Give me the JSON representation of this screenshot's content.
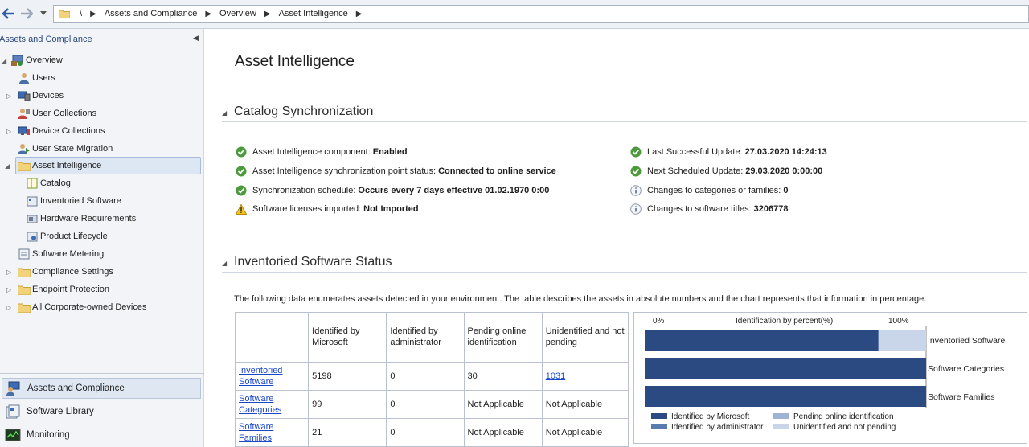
{
  "breadcrumb": {
    "root": "\\",
    "items": [
      "Assets and Compliance",
      "Overview",
      "Asset Intelligence"
    ]
  },
  "nav": {
    "header": "Assets and Compliance",
    "tree": [
      {
        "label": "Overview",
        "icon": "overview-icon"
      },
      {
        "label": "Users",
        "icon": "user-icon"
      },
      {
        "label": "Devices",
        "icon": "devices-icon"
      },
      {
        "label": "User Collections",
        "icon": "user-collection-icon"
      },
      {
        "label": "Device Collections",
        "icon": "device-collection-icon"
      },
      {
        "label": "User State Migration",
        "icon": "migration-icon"
      },
      {
        "label": "Asset Intelligence",
        "icon": "folder-icon"
      },
      {
        "label": "Catalog",
        "icon": "catalog-icon"
      },
      {
        "label": "Inventoried Software",
        "icon": "software-icon"
      },
      {
        "label": "Hardware Requirements",
        "icon": "hardware-icon"
      },
      {
        "label": "Product Lifecycle",
        "icon": "lifecycle-icon"
      },
      {
        "label": "Software Metering",
        "icon": "metering-icon"
      },
      {
        "label": "Compliance Settings",
        "icon": "folder-icon"
      },
      {
        "label": "Endpoint Protection",
        "icon": "folder-icon"
      },
      {
        "label": "All Corporate-owned Devices",
        "icon": "folder-icon"
      }
    ],
    "workspaces": [
      {
        "label": "Assets and Compliance",
        "icon": "assets-icon"
      },
      {
        "label": "Software Library",
        "icon": "library-icon"
      },
      {
        "label": "Monitoring",
        "icon": "monitoring-icon"
      }
    ]
  },
  "page": {
    "title": "Asset Intelligence",
    "catalog_section": "Catalog Synchronization",
    "inventory_section": "Inventoried Software Status",
    "status_left": [
      {
        "label": "Asset Intelligence component:",
        "value": "Enabled",
        "icon": "check-icon"
      },
      {
        "label": "Asset Intelligence synchronization point status:",
        "value": "Connected to online service",
        "icon": "check-icon"
      },
      {
        "label": "Synchronization schedule:",
        "value": "Occurs every 7 days effective 01.02.1970 0:00",
        "icon": "check-icon"
      },
      {
        "label": "Software licenses imported:",
        "value": "Not Imported",
        "icon": "warning-icon"
      }
    ],
    "status_right": [
      {
        "label": "Last Successful Update:",
        "value": "27.03.2020 14:24:13",
        "icon": "check-icon"
      },
      {
        "label": "Next Scheduled Update:",
        "value": "29.03.2020 0:00:00",
        "icon": "check-icon"
      },
      {
        "label": "Changes to categories or families:",
        "value": "0",
        "icon": "info-icon"
      },
      {
        "label": "Changes to software titles:",
        "value": "3206778",
        "icon": "info-icon"
      }
    ],
    "description": "The following data enumerates assets detected in your environment. The table describes the assets in absolute numbers and the chart represents that information in percentage."
  },
  "table": {
    "headers": [
      "",
      "Identified by Microsoft",
      "Identified by administrator",
      "Pending online identification",
      "Unidentified and not pending"
    ],
    "rows": [
      {
        "name": "Inventoried Software",
        "cells": [
          "5198",
          "0",
          "30",
          "1031"
        ]
      },
      {
        "name": "Software Categories",
        "cells": [
          "99",
          "0",
          "Not Applicable",
          "Not Applicable"
        ]
      },
      {
        "name": "Software Families",
        "cells": [
          "21",
          "0",
          "Not Applicable",
          "Not Applicable"
        ]
      }
    ]
  },
  "chart_data": {
    "type": "bar",
    "orientation": "horizontal",
    "stacked": true,
    "title": "Identification by percent(%)",
    "axis_min_label": "0%",
    "axis_max_label": "100%",
    "xlim": [
      0,
      100
    ],
    "categories": [
      "Inventoried Software",
      "Software Categories",
      "Software Families"
    ],
    "series": [
      {
        "name": "Identified by Microsoft",
        "color": "#2b4a82",
        "values": [
          83.0,
          100,
          100
        ]
      },
      {
        "name": "Identified by administrator",
        "color": "#5a7bb0",
        "values": [
          0,
          0,
          0
        ]
      },
      {
        "name": "Pending online identification",
        "color": "#9db2d4",
        "values": [
          0.5,
          0,
          0
        ]
      },
      {
        "name": "Unidentified and not pending",
        "color": "#c9d6ea",
        "values": [
          16.5,
          0,
          0
        ]
      }
    ],
    "legend_position": "bottom"
  }
}
